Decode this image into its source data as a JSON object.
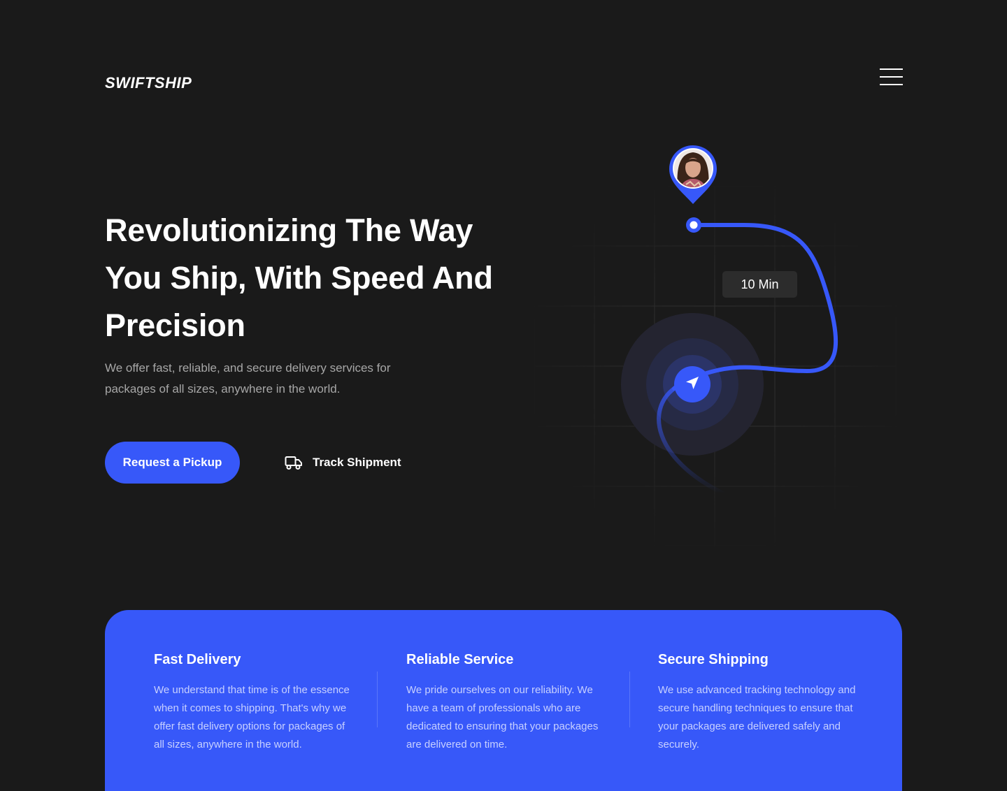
{
  "brand": {
    "name": "SWIFTSHIP"
  },
  "header": {
    "menu_icon": "hamburger-menu-icon"
  },
  "hero": {
    "title": "Revolutionizing The Way You Ship, With Speed And Precision",
    "subtitle": "We offer fast, reliable, and secure delivery services for packages of all sizes, anywhere in the world.",
    "primary_button": "Request a Pickup",
    "secondary_button": "Track Shipment",
    "secondary_icon": "truck-icon"
  },
  "map": {
    "eta_label": "10 Min",
    "destination_icon": "avatar-location-pin-icon",
    "current_icon": "navigation-arrow-icon"
  },
  "colors": {
    "background": "#1a1a1a",
    "accent": "#3758f9",
    "muted_text": "#a7a7a7"
  },
  "features": [
    {
      "title": "Fast Delivery",
      "description": "We understand that time is of the essence when it comes to shipping. That's why we offer fast delivery options for packages of all sizes, anywhere in the world."
    },
    {
      "title": "Reliable Service",
      "description": "We pride ourselves on our reliability. We have a team of professionals who are dedicated to ensuring that your packages are delivered on time."
    },
    {
      "title": "Secure Shipping",
      "description": "We use advanced tracking technology and secure handling techniques to ensure that your packages are delivered safely and securely."
    }
  ]
}
